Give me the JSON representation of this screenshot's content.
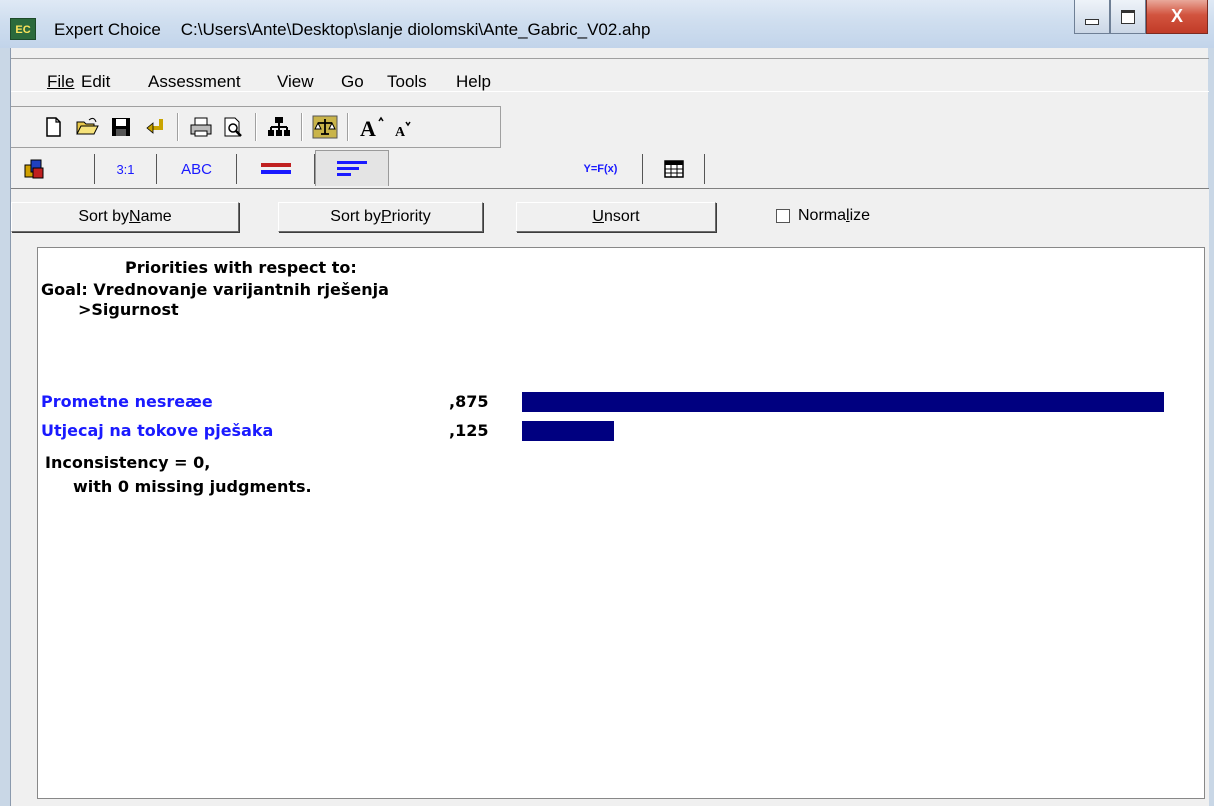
{
  "window": {
    "app_name": "Expert Choice",
    "file_path": "C:\\Users\\Ante\\Desktop\\slanje diolomski\\Ante_Gabric_V02.ahp",
    "app_icon_text": "EC",
    "close_glyph": "X"
  },
  "menu": [
    "File",
    "Edit",
    "Assessment",
    "View",
    "Go",
    "Tools",
    "Help"
  ],
  "tabs": {
    "pairwise_label": "3:1",
    "verbal_label": "ABC",
    "formula_label": "Y=F(x)"
  },
  "buttons": {
    "sort_by_name": "Sort by Name",
    "sort_by_priority": "Sort by Priority",
    "unsort": "Unsort",
    "normalize": "Normalize",
    "normalize_checked": false
  },
  "results": {
    "header": "Priorities with respect to:",
    "goal": "Goal: Vrednovanje varijantnih rješenja",
    "node": ">Sigurnost",
    "items": [
      {
        "name": "Prometne nesreæe",
        "value_label": ",875",
        "value": 0.875
      },
      {
        "name": "Utjecaj na tokove pješaka",
        "value_label": ",125",
        "value": 0.125
      }
    ],
    "inconsistency": "Inconsistency = 0,",
    "missing": "with 0  missing judgments.",
    "bar_color": "#000080",
    "label_color": "#1a1aff"
  }
}
